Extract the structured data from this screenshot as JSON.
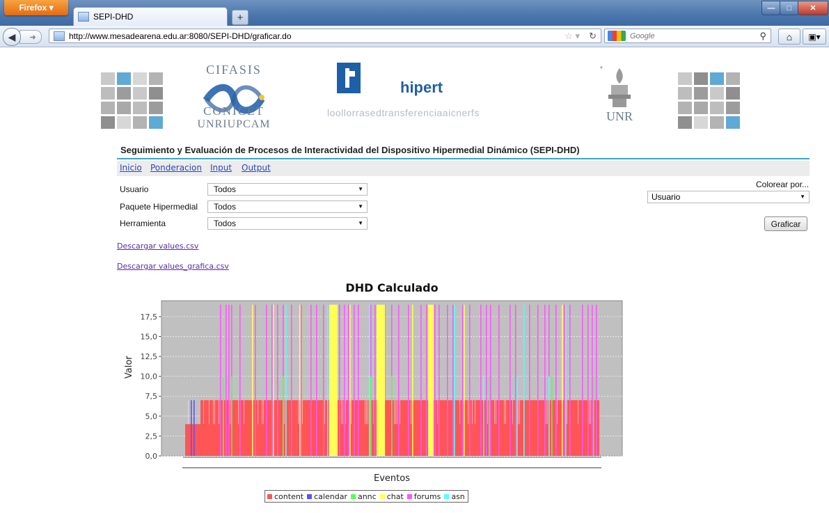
{
  "browser": {
    "menu_button": "Firefox",
    "tab_title": "SEPI-DHD",
    "url": "http://www.mesadearena.edu.ar:8080/SEPI-DHD/graficar.do",
    "search_placeholder": "Google"
  },
  "logos": {
    "cifasis_top": "CIFASIS",
    "cifasis_mid": "CONICET",
    "cifasis_bottom": "UNRIUPCAM",
    "hipert_name": "hipert",
    "hipert_sub": "loollorrasedtransferenciaaicnerfs",
    "unr": "UNR"
  },
  "page": {
    "title": "Seguimiento y Evaluación de Procesos de Interactividad del Dispositivo Hipermedial Dinámico (SEPI-DHD)"
  },
  "menu": [
    "Inicio",
    "Ponderacion",
    "Input",
    "Output"
  ],
  "filters": [
    {
      "label": "Usuario",
      "value": "Todos"
    },
    {
      "label": "Paquete Hipermedial",
      "value": "Todos"
    },
    {
      "label": "Herramienta",
      "value": "Todos"
    }
  ],
  "color_by": {
    "label": "Colorear por...",
    "value": "Usuario"
  },
  "graficar_label": "Graficar",
  "downloads": [
    "Descargar values.csv",
    "Descargar values_grafica.csv"
  ],
  "chart_data": {
    "type": "bar",
    "title": "DHD Calculado",
    "xlabel": "Eventos",
    "ylabel": "Valor",
    "ylim": [
      0,
      19.5
    ],
    "yticks": [
      "0,0",
      "2,5",
      "5,0",
      "7,5",
      "10,0",
      "12,5",
      "15,0",
      "17,5"
    ],
    "ytick_values": [
      0,
      2.5,
      5,
      7.5,
      10,
      12.5,
      15,
      17.5
    ],
    "grid": true,
    "legend": "bottom",
    "series": [
      {
        "name": "content",
        "color": "#ff5555"
      },
      {
        "name": "calendar",
        "color": "#5555ff"
      },
      {
        "name": "annc",
        "color": "#55ff55"
      },
      {
        "name": "chat",
        "color": "#ffff55"
      },
      {
        "name": "forums",
        "color": "#ff55ff"
      },
      {
        "name": "asn",
        "color": "#55ffff"
      }
    ],
    "values": {
      "content_levels": [
        4,
        7
      ],
      "calendar": 7,
      "annc": 10,
      "chat": 19,
      "forums": 19,
      "asn": 19
    }
  }
}
